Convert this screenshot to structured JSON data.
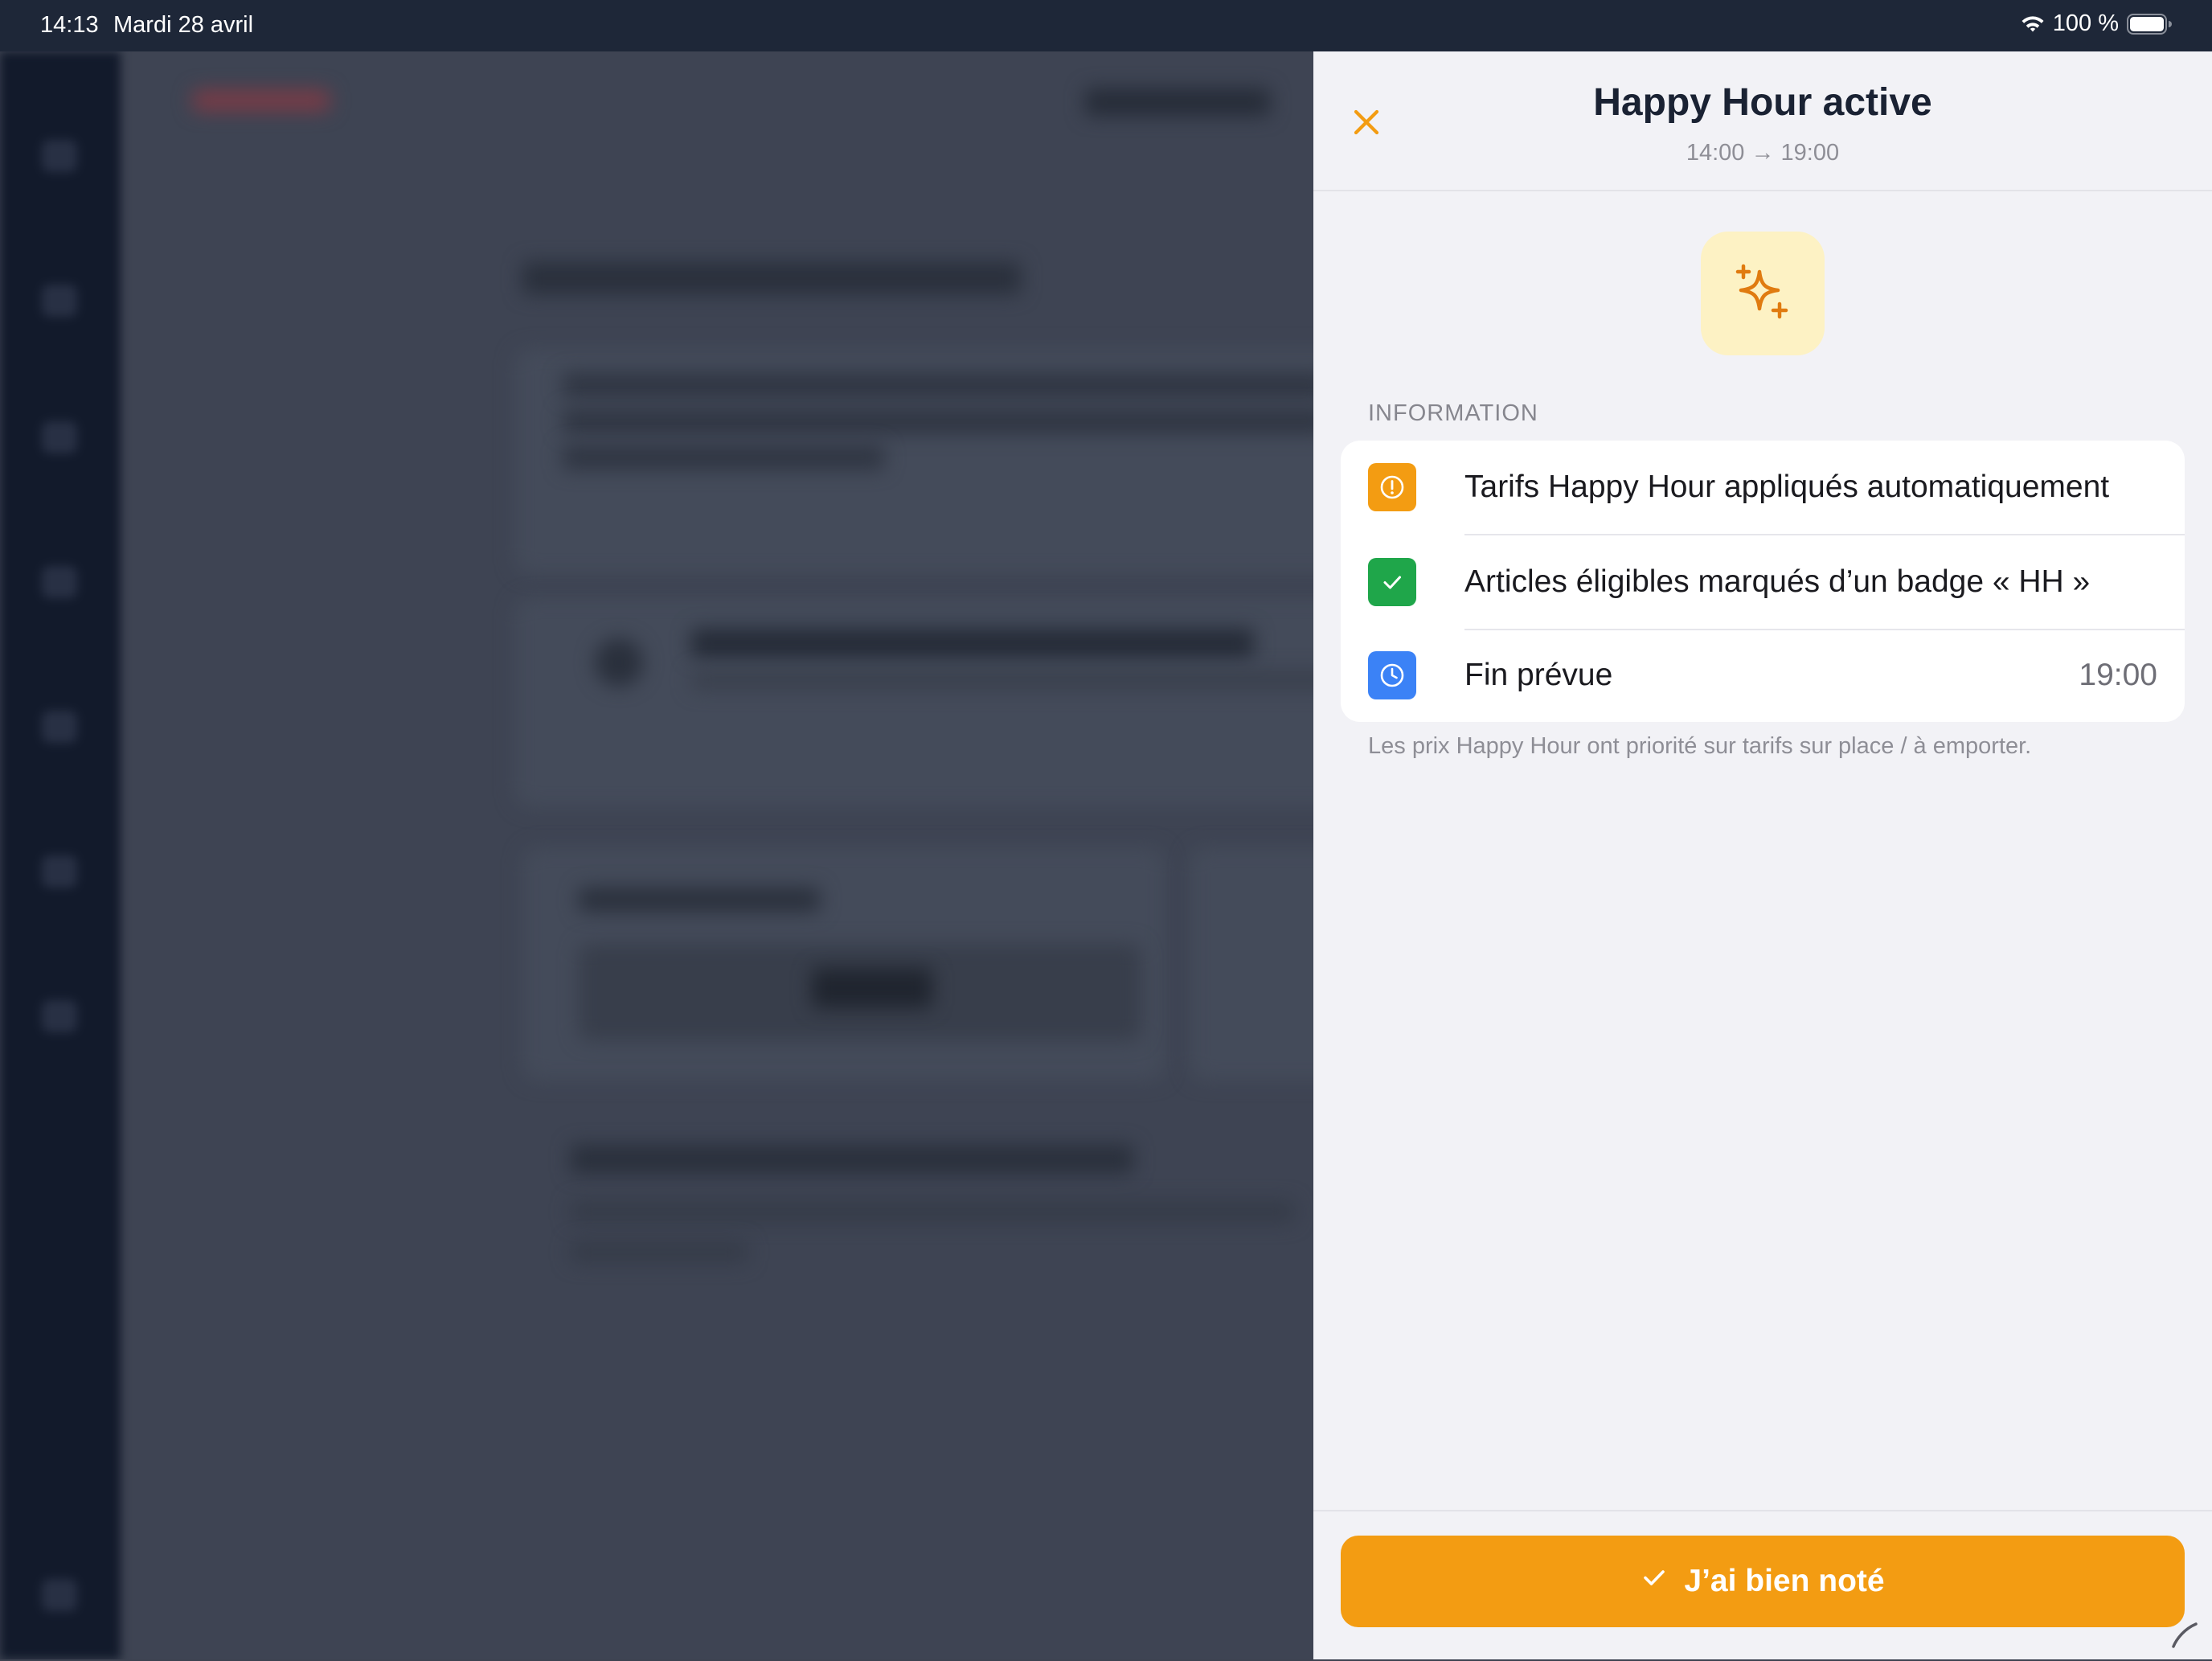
{
  "status_bar": {
    "time": "14:13",
    "date": "Mardi 28 avril",
    "battery": "100 %"
  },
  "sheet": {
    "title": "Happy Hour active",
    "subtitle": "14:00 → 19:00",
    "hero_icon": "sparkles-icon",
    "section_label": "INFORMATION",
    "rows": [
      {
        "icon": "alert-circle-icon",
        "color": "#f39c12",
        "label": "Tarifs Happy Hour appliqués automatiquement"
      },
      {
        "icon": "checkmark-icon",
        "color": "#1fa64a",
        "label": "Articles éligibles marqués d’un badge « HH »"
      },
      {
        "icon": "clock-icon",
        "color": "#3b82f6",
        "label": "Fin prévue",
        "value": "19:00"
      }
    ],
    "footnote": "Les prix Happy Hour ont priorité sur tarifs sur place / à emporter.",
    "confirm_label": "J’ai bien noté"
  },
  "colors": {
    "accent": "#f39c12",
    "success": "#1fa64a",
    "info": "#3b82f6"
  }
}
